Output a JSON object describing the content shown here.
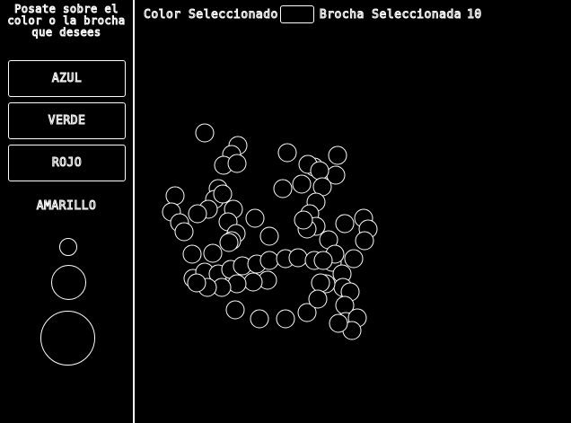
{
  "sidebar": {
    "instruction_lines": [
      "Posate sobre el",
      "color o la brocha",
      "que desees"
    ],
    "buttons": [
      {
        "label": "AZUL"
      },
      {
        "label": "VERDE"
      },
      {
        "label": "ROJO"
      }
    ],
    "amarillo_label": "AMARILLO",
    "brush_sizes": [
      "small",
      "medium",
      "large"
    ]
  },
  "topbar": {
    "color_label": "Color Seleccionado",
    "brush_label": "Brocha Seleccionada",
    "brush_value": "10"
  },
  "colors": {
    "background": "#000000",
    "foreground": "#ffffff",
    "selected_color": "#000000"
  },
  "icons": [
    "small-brush-icon",
    "medium-brush-icon",
    "large-brush-icon"
  ]
}
